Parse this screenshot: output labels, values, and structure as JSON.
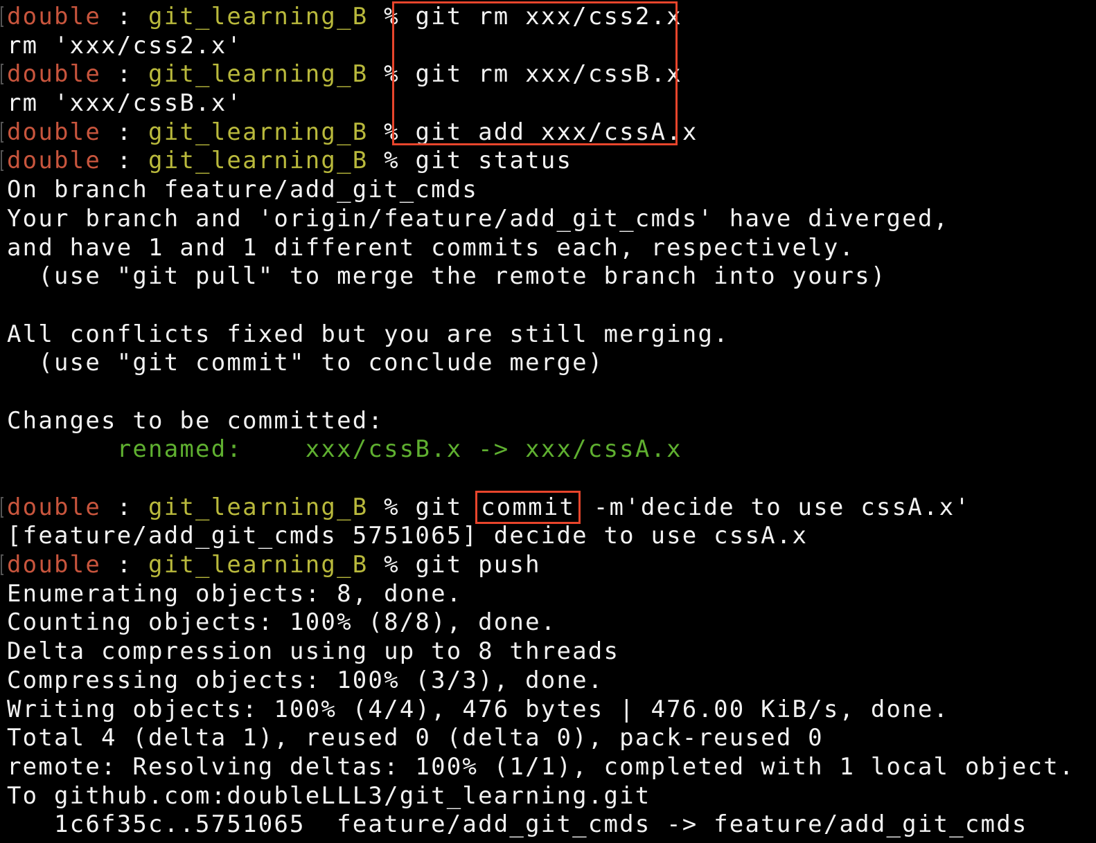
{
  "terminal": {
    "prompt": {
      "user": "double",
      "separator": " : ",
      "dir": "git_learning_B",
      "symbol": " % "
    },
    "lines": [
      {
        "kind": "prompt",
        "cmd": "git rm xxx/css2.x"
      },
      {
        "kind": "out",
        "text": "rm 'xxx/css2.x'"
      },
      {
        "kind": "prompt",
        "cmd": "git rm xxx/cssB.x"
      },
      {
        "kind": "out",
        "text": "rm 'xxx/cssB.x'"
      },
      {
        "kind": "prompt",
        "cmd": "git add xxx/cssA.x"
      },
      {
        "kind": "prompt",
        "cmd": "git status"
      },
      {
        "kind": "out",
        "text": "On branch feature/add_git_cmds"
      },
      {
        "kind": "out",
        "text": "Your branch and 'origin/feature/add_git_cmds' have diverged,"
      },
      {
        "kind": "out",
        "text": "and have 1 and 1 different commits each, respectively."
      },
      {
        "kind": "out",
        "text": "  (use \"git pull\" to merge the remote branch into yours)"
      },
      {
        "kind": "out",
        "text": ""
      },
      {
        "kind": "out",
        "text": "All conflicts fixed but you are still merging."
      },
      {
        "kind": "out",
        "text": "  (use \"git commit\" to conclude merge)"
      },
      {
        "kind": "out",
        "text": ""
      },
      {
        "kind": "out",
        "text": "Changes to be committed:"
      },
      {
        "kind": "renamed",
        "label": "renamed:",
        "text": "xxx/cssB.x -> xxx/cssA.x"
      },
      {
        "kind": "out",
        "text": ""
      },
      {
        "kind": "prompt-commit",
        "cmd_pre": "git ",
        "cmd_hl": "commit",
        "cmd_post": " -m'decide to use cssA.x'"
      },
      {
        "kind": "out",
        "text": "[feature/add_git_cmds 5751065] decide to use cssA.x"
      },
      {
        "kind": "prompt",
        "cmd": "git push"
      },
      {
        "kind": "out",
        "text": "Enumerating objects: 8, done."
      },
      {
        "kind": "out",
        "text": "Counting objects: 100% (8/8), done."
      },
      {
        "kind": "out",
        "text": "Delta compression using up to 8 threads"
      },
      {
        "kind": "out",
        "text": "Compressing objects: 100% (3/3), done."
      },
      {
        "kind": "out",
        "text": "Writing objects: 100% (4/4), 476 bytes | 476.00 KiB/s, done."
      },
      {
        "kind": "out",
        "text": "Total 4 (delta 1), reused 0 (delta 0), pack-reused 0"
      },
      {
        "kind": "out",
        "text": "remote: Resolving deltas: 100% (1/1), completed with 1 local object."
      },
      {
        "kind": "out",
        "text": "To github.com:doubleLLL3/git_learning.git"
      },
      {
        "kind": "out",
        "text": "   1c6f35c..5751065  feature/add_git_cmds -> feature/add_git_cmds"
      }
    ]
  },
  "colors": {
    "background": "#000000",
    "text": "#f2f2f2",
    "user": "#c8553d",
    "dir": "#b9b93c",
    "status_green": "#5fb030",
    "highlight_box": "#e8452c"
  }
}
